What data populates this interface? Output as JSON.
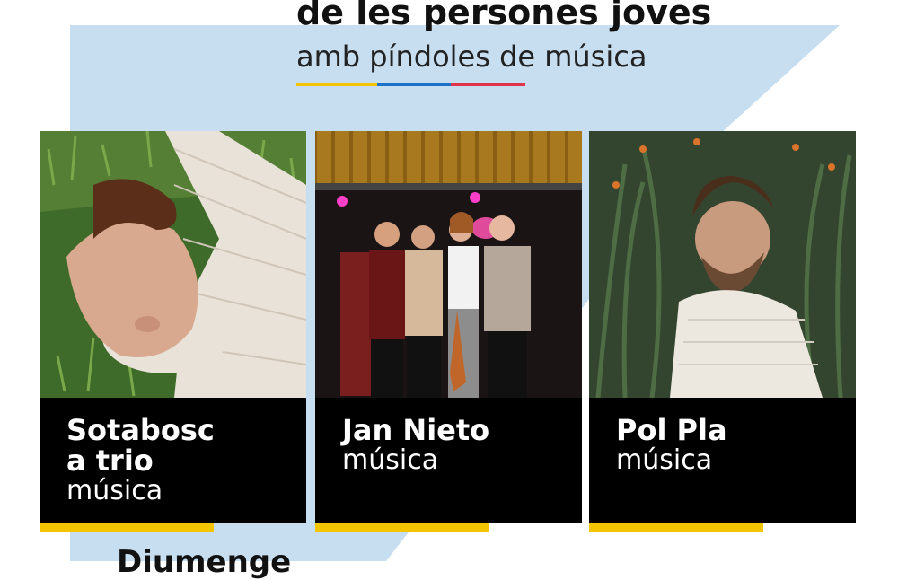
{
  "header": {
    "title_line": "de les persones joves",
    "subtitle": "amb píndoles de música"
  },
  "colors": {
    "background_shape": "#c6def0",
    "stripe_yellow": "#f5c400",
    "stripe_blue": "#1a73c8",
    "stripe_red": "#e0344a",
    "card_bg": "#000000",
    "underbar": "#f5c400"
  },
  "cards": [
    {
      "name_line1": "Sotabosc",
      "name_line2": "a trio",
      "kind": "música"
    },
    {
      "name_line1": "Jan Nieto",
      "kind": "música"
    },
    {
      "name_line1": "Pol Pla",
      "kind": "música"
    }
  ],
  "footer": {
    "partial_text": "Diumenge"
  }
}
